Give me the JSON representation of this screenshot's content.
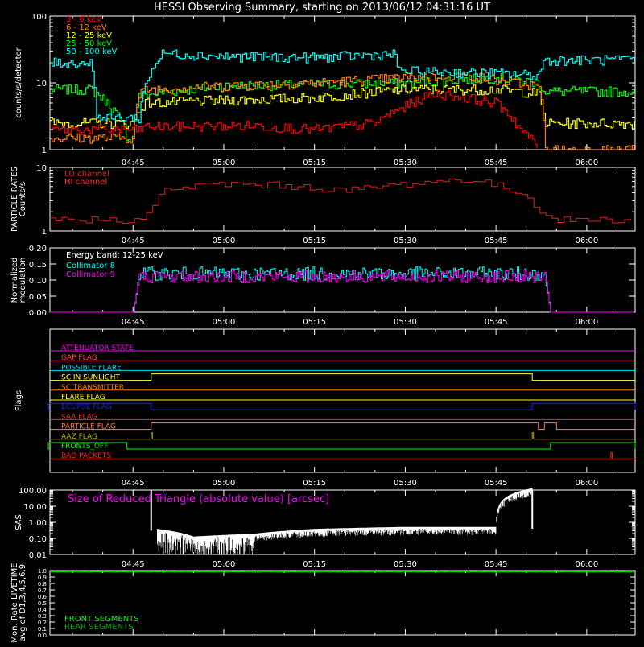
{
  "title": "HESSI Observing Summary, starting on 2013/06/12 04:31:16 UT",
  "colors": {
    "background": "#000000",
    "axes": "#ffffff",
    "band_3_6": "#ff0000",
    "band_6_12": "#ff8000",
    "band_12_25": "#ffff00",
    "band_25_50": "#00ff00",
    "band_50_100": "#00ffff",
    "lo_channel": "#e02020",
    "hi_channel": "#ff3030",
    "collimator_8": "#00ffff",
    "collimator_9": "#ff00ff",
    "sas": "#ffffff",
    "front_segments": "#00ff00",
    "rear_segments": "#00b000"
  },
  "chart_data": [
    {
      "id": "count-rates",
      "type": "line",
      "ylabel": "counts/s/detector",
      "yscale": "log",
      "ylim": [
        1,
        100
      ],
      "yticks": [
        "1",
        "10",
        "100"
      ],
      "xticks": [
        "04:45",
        "05:00",
        "05:15",
        "05:30",
        "05:45",
        "06:00"
      ],
      "series": [
        {
          "name": "3 - 6  keV",
          "color": "#ff0000",
          "x": [
            "04:31",
            "04:46",
            "04:47",
            "05:05",
            "05:15",
            "05:25",
            "05:29",
            "05:35",
            "05:45",
            "05:49",
            "05:52"
          ],
          "values": [
            2,
            2,
            2.2,
            2.3,
            2.0,
            2.5,
            4,
            7,
            5,
            2,
            1
          ]
        },
        {
          "name": "6 - 12  keV",
          "color": "#ff8000",
          "x": [
            "04:31",
            "04:45",
            "04:46",
            "04:47",
            "05:00",
            "05:15",
            "05:30",
            "05:40",
            "05:45",
            "05:52",
            "05:53",
            "06:08"
          ],
          "values": [
            1.5,
            1.5,
            6.5,
            8,
            9,
            10,
            12,
            13,
            11,
            9,
            1,
            1
          ]
        },
        {
          "name": "12 - 25  keV",
          "color": "#ffff00",
          "x": [
            "04:31",
            "04:45",
            "04:46",
            "04:47",
            "05:00",
            "05:15",
            "05:30",
            "05:45",
            "05:52",
            "05:53",
            "06:08"
          ],
          "values": [
            2.5,
            2.5,
            4,
            5,
            5.5,
            6,
            8,
            8,
            7,
            2.5,
            2.5
          ]
        },
        {
          "name": "25 - 50  keV",
          "color": "#00ff00",
          "x": [
            "04:31",
            "04:38",
            "04:44",
            "04:45",
            "04:46",
            "05:00",
            "05:15",
            "05:30",
            "05:45",
            "05:52",
            "05:53",
            "06:08"
          ],
          "values": [
            8,
            8,
            1.5,
            1.5,
            6.5,
            9,
            9.5,
            10,
            12,
            10,
            7.5,
            7.5
          ]
        },
        {
          "name": "50 - 100  keV",
          "color": "#00ffff",
          "x": [
            "04:31",
            "04:38",
            "04:39",
            "04:46",
            "04:47",
            "04:50",
            "05:00",
            "05:15",
            "05:28",
            "05:29",
            "05:45",
            "05:52",
            "05:53",
            "06:08"
          ],
          "values": [
            20,
            20,
            3,
            3,
            9,
            28,
            25,
            24,
            27,
            15,
            14,
            13,
            22,
            22
          ]
        }
      ]
    },
    {
      "id": "particle-rates",
      "type": "line",
      "ylabel": "PARTICLE RATES\nCounts/s",
      "yscale": "log",
      "ylim": [
        1,
        10
      ],
      "yticks": [
        "1",
        "10"
      ],
      "xticks": [
        "04:45",
        "05:00",
        "05:15",
        "05:30",
        "05:45",
        "06:00"
      ],
      "series": [
        {
          "name": "LO channel",
          "color": "#e02020",
          "x": [
            "04:31",
            "04:46",
            "04:48",
            "04:50",
            "05:00",
            "05:10",
            "05:20",
            "05:30",
            "05:40",
            "05:45",
            "05:50",
            "05:52",
            "05:54",
            "06:08"
          ],
          "values": [
            1.5,
            1.5,
            2,
            4.5,
            5.5,
            5.2,
            4.3,
            5.5,
            6.5,
            5.2,
            3.5,
            2.2,
            1.5,
            1.5
          ]
        },
        {
          "name": "HI channel",
          "color": "#ff3030",
          "x": [],
          "values": []
        }
      ]
    },
    {
      "id": "modulation",
      "type": "line",
      "ylabel": "Normalized\nmodulation",
      "ylim": [
        0.0,
        0.2
      ],
      "yticks": [
        "0.00",
        "0.05",
        "0.10",
        "0.15",
        "0.20"
      ],
      "xticks": [
        "04:45",
        "05:00",
        "05:15",
        "05:30",
        "05:45",
        "06:00"
      ],
      "annotation": "Energy band: 12-25 keV",
      "series": [
        {
          "name": "Collimator 8",
          "color": "#00ffff",
          "x": [
            "04:31",
            "04:45",
            "04:46",
            "05:53",
            "05:54",
            "06:08"
          ],
          "values": [
            0.0,
            0.0,
            0.12,
            0.12,
            0.0,
            0.0
          ]
        },
        {
          "name": "Collimator 9",
          "color": "#ff00ff",
          "x": [
            "04:31",
            "04:45",
            "04:46",
            "05:53",
            "05:54",
            "06:08"
          ],
          "values": [
            0.0,
            0.0,
            0.11,
            0.11,
            0.0,
            0.0
          ]
        }
      ]
    },
    {
      "id": "flags",
      "type": "line",
      "ylabel": "Flags",
      "xticks": [
        "04:45",
        "05:00",
        "05:15",
        "05:30",
        "05:45",
        "06:00"
      ],
      "series": [
        {
          "name": "ATTENUATOR STATE",
          "color": "#ff00ff",
          "transitions": []
        },
        {
          "name": "GAP FLAG",
          "color": "#ff4040",
          "transitions": []
        },
        {
          "name": "POSSIBLE FLARE",
          "color": "#00e0e0",
          "transitions": []
        },
        {
          "name": "SC IN SUNLIGHT",
          "color": "#ffff40",
          "on": [
            [
              "04:48",
              "05:51"
            ]
          ]
        },
        {
          "name": "SC TRANSMITTER",
          "color": "#ff8000",
          "transitions": []
        },
        {
          "name": "FLARE FLAG",
          "color": "#ffff00",
          "transitions": []
        },
        {
          "name": "ECLIPSE FLAG",
          "color": "#2020ff",
          "on": [
            [
              "04:31",
              "04:48"
            ],
            [
              "05:51",
              "06:08"
            ]
          ]
        },
        {
          "name": "SAA FLAG",
          "color": "#e03030",
          "transitions": []
        },
        {
          "name": "PARTICLE FLAG",
          "color": "#ff8040",
          "on": [
            [
              "04:48",
              "05:52"
            ],
            [
              "05:53",
              "05:55"
            ]
          ]
        },
        {
          "name": "AAZ FLAG",
          "color": "#b0b000",
          "on": [
            [
              "04:48",
              "04:48"
            ],
            [
              "05:51",
              "05:51"
            ]
          ]
        },
        {
          "name": "FRONTS_OFF",
          "color": "#00ff00",
          "on": [
            [
              "04:31",
              "04:44"
            ],
            [
              "05:54",
              "06:08"
            ]
          ]
        },
        {
          "name": "BAD PACKETS",
          "color": "#ff2020",
          "on": [
            [
              "06:04",
              "06:04"
            ]
          ]
        }
      ]
    },
    {
      "id": "sas",
      "type": "line",
      "ylabel": "SAS",
      "yscale": "log",
      "ylim": [
        0.01,
        100
      ],
      "yticks": [
        "0.01",
        "0.10",
        "1.00",
        "10.00",
        "100.00"
      ],
      "xticks": [
        "04:45",
        "05:00",
        "05:15",
        "05:30",
        "05:45",
        "06:00"
      ],
      "annotation": "Size of Reduced Triangle (absolute value) [arcsec]",
      "series": [
        {
          "name": "",
          "color": "#ffffff",
          "x": [
            "04:48",
            "04:49",
            "04:55",
            "05:05",
            "05:15",
            "05:30",
            "05:45",
            "05:51"
          ],
          "values": [
            100,
            0.3,
            0.1,
            0.15,
            0.3,
            0.4,
            0.4,
            100
          ]
        }
      ]
    },
    {
      "id": "livetime",
      "type": "line",
      "ylabel": "Mon. Rate LIVETIME\navg of D1,3,4,5,6,9",
      "ylim": [
        0.0,
        1.0
      ],
      "yticks": [
        "0.0",
        "0.1",
        "0.2",
        "0.3",
        "0.4",
        "0.5",
        "0.6",
        "0.7",
        "0.8",
        "0.9",
        "1.0"
      ],
      "series": [
        {
          "name": "FRONT SEGMENTS",
          "color": "#00ff00",
          "x": [
            "04:31",
            "06:08"
          ],
          "values": [
            0.98,
            0.98
          ]
        },
        {
          "name": "REAR SEGMENTS",
          "color": "#00b000",
          "x": [
            "04:31",
            "06:08"
          ],
          "values": [
            0.99,
            0.99
          ]
        }
      ]
    }
  ]
}
